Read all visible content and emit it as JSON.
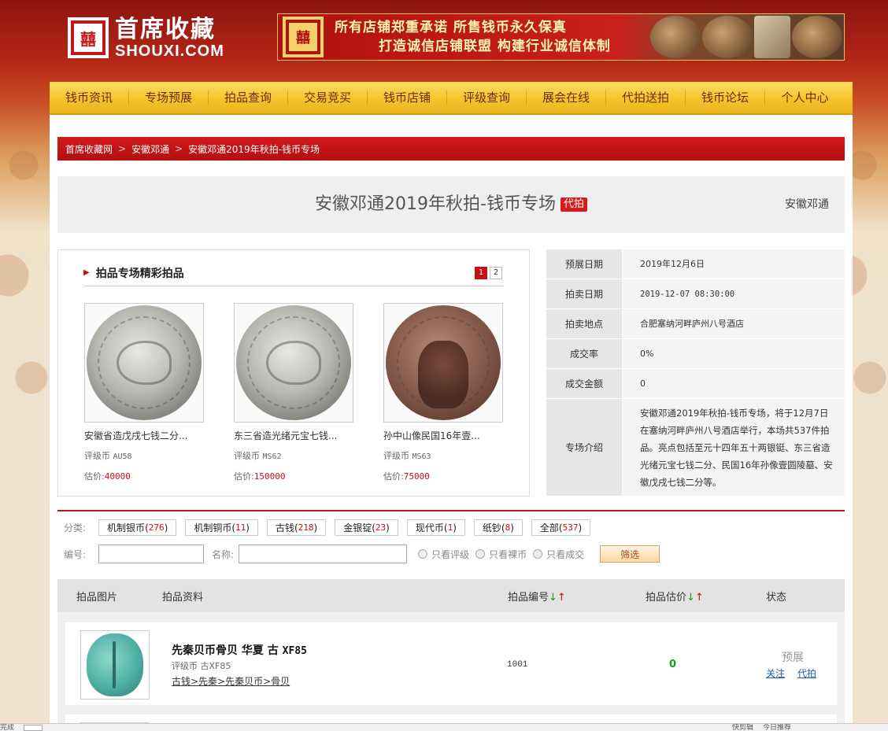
{
  "header": {
    "logo_seal": "囍",
    "logo_cn": "首席收藏",
    "logo_en": "SHOUXI.COM",
    "banner_seal": "囍",
    "banner_line1": "所有店铺郑重承诺 所售钱币永久保真",
    "banner_line2": "打造诚信店铺联盟 构建行业诚信体制"
  },
  "nav": [
    "钱币资讯",
    "专场预展",
    "拍品查询",
    "交易竞买",
    "钱币店铺",
    "评级查询",
    "展会在线",
    "代拍送拍",
    "钱币论坛",
    "个人中心"
  ],
  "breadcrumb": {
    "items": [
      "首席收藏网",
      "安徽邓通",
      "安徽邓通2019年秋拍-钱币专场"
    ],
    "separator": ">"
  },
  "title": {
    "text": "安徽邓通2019年秋拍-钱币专场",
    "tag": "代拍",
    "org": "安徽邓通"
  },
  "featured": {
    "heading": "拍品专场精彩拍品",
    "pages": [
      "1",
      "2"
    ],
    "active_page": "1",
    "items": [
      {
        "name": "安徽省造戊戌七钱二分...",
        "grade_label": "评级币",
        "grade": "AU58",
        "est_label": "估价:",
        "est": "40000"
      },
      {
        "name": "东三省造光绪元宝七钱...",
        "grade_label": "评级币",
        "grade": "MS62",
        "est_label": "估价:",
        "est": "150000"
      },
      {
        "name": "孙中山像民国16年壹...",
        "grade_label": "评级币",
        "grade": "MS63",
        "est_label": "估价:",
        "est": "75000"
      }
    ]
  },
  "info": {
    "preview_label": "预展日期",
    "preview": "2019年12月6日",
    "auction_label": "拍卖日期",
    "auction": "2019-12-07 08:30:00",
    "place_label": "拍卖地点",
    "place": "合肥塞纳河畔庐州八号酒店",
    "rate_label": "成交率",
    "rate": "0%",
    "amount_label": "成交金额",
    "amount": "0",
    "intro_label": "专场介绍",
    "intro": "安徽邓通2019年秋拍-钱币专场，将于12月7日在塞纳河畔庐州八号酒店举行，本场共537件拍品。亮点包括至元十四年五十两银铤、东三省造光绪元宝七钱二分、民国16年孙像壹圆陵墓、安徽戊戌七钱二分等。"
  },
  "filter": {
    "category_label": "分类:",
    "categories": [
      {
        "name": "机制银币",
        "count": "276"
      },
      {
        "name": "机制铜币",
        "count": "11"
      },
      {
        "name": "古钱",
        "count": "218"
      },
      {
        "name": "金银锭",
        "count": "23"
      },
      {
        "name": "现代币",
        "count": "1"
      },
      {
        "name": "纸钞",
        "count": "8"
      },
      {
        "name": "全部",
        "count": "537"
      }
    ],
    "number_label": "编号:",
    "name_label": "名称:",
    "opt_graded": "只看评级",
    "opt_raw": "只看裸币",
    "opt_sold": "只看成交",
    "submit": "筛选"
  },
  "list": {
    "col_pic": "拍品图片",
    "col_info": "拍品资料",
    "col_no": "拍品编号",
    "col_est": "拍品估价",
    "col_status": "状态",
    "arrow_down": "↓",
    "arrow_up": "↑",
    "rows": [
      {
        "name": "先秦贝币骨贝 华夏 古",
        "grade": "XF85",
        "sub": "评级币 古XF85",
        "path": "古钱>先秦>先秦贝币>骨贝",
        "no": "1001",
        "est": "0",
        "status": "预展",
        "follow": "关注",
        "proxy": "代拍"
      }
    ]
  },
  "statusbar": {
    "left": "完成",
    "right1": "快剪辑",
    "right2": "今日推荐"
  },
  "colors": {
    "brand_red": "#c81010",
    "nav_yellow": "#f5c52c",
    "green": "#1a9a1a",
    "link_blue": "#1d5fb4"
  }
}
